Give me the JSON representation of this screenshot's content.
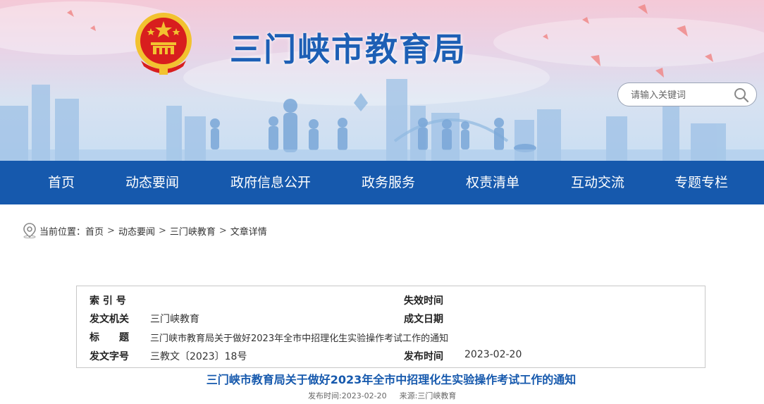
{
  "header": {
    "site_title": "三门峡市教育局",
    "search_placeholder": "请输入关键词"
  },
  "nav": {
    "items": [
      "首页",
      "动态要闻",
      "政府信息公开",
      "政务服务",
      "权责清单",
      "互动交流",
      "专题专栏"
    ]
  },
  "breadcrumb": {
    "prefix": "当前位置：",
    "items": [
      "首页",
      "动态要闻",
      "三门峡教育",
      "文章详情"
    ],
    "separator": ">"
  },
  "info": {
    "index_label": "索 引 号",
    "index_value": "",
    "expire_label": "失效时间",
    "expire_value": "",
    "issuer_label": "发文机关",
    "issuer_value": "三门峡教育",
    "created_label": "成文日期",
    "created_value": "",
    "title_label": "标　　题",
    "title_value": "三门峡市教育局关于做好2023年全市中招理化生实验操作考试工作的通知",
    "docno_label": "发文字号",
    "docno_value": "三教文〔2023〕18号",
    "publish_label": "发布时间",
    "publish_value": "2023-02-20"
  },
  "article": {
    "title": "三门峡市教育局关于做好2023年全市中招理化生实验操作考试工作的通知",
    "meta_time": "发布时间:2023-02-20",
    "meta_source": "来源:三门峡教育"
  },
  "colors": {
    "nav_bg": "#1659ad",
    "title_blue": "#1d5fb5",
    "emblem_red": "#d81e1e",
    "emblem_gold": "#f2c230"
  },
  "icons": {
    "search": "search-icon",
    "location": "location-pin-icon",
    "emblem": "national-emblem-icon"
  }
}
